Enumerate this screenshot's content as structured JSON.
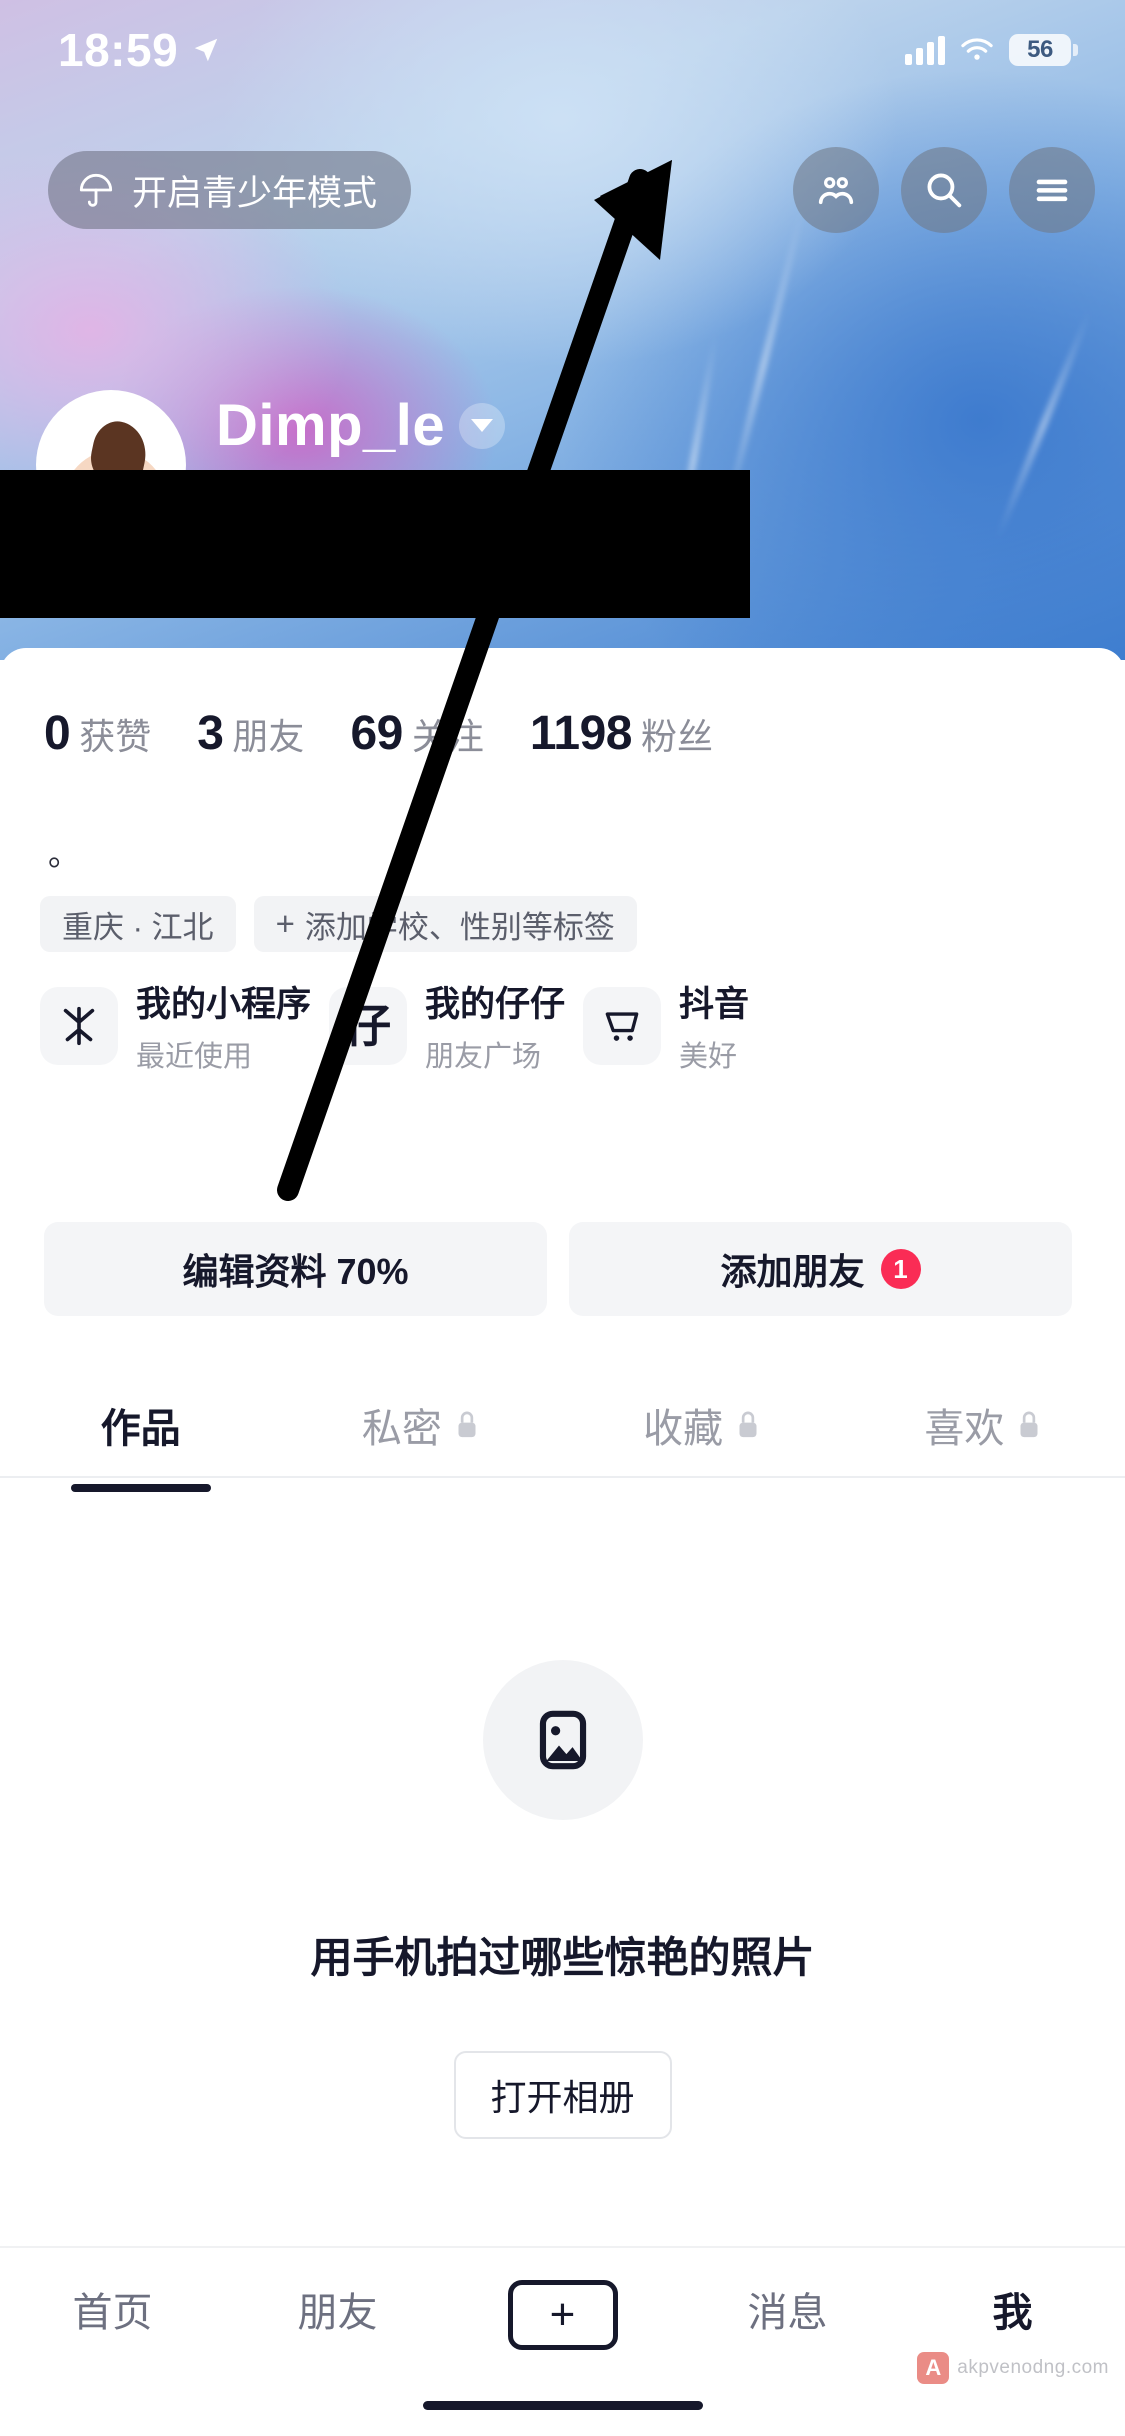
{
  "status_bar": {
    "time": "18:59",
    "location_icon": "location-arrow-icon",
    "signal_icon": "cellular-signal-icon",
    "wifi_icon": "wifi-icon",
    "battery_level": "56"
  },
  "header": {
    "teen_mode_label": "开启青少年模式",
    "teen_mode_icon": "umbrella-icon",
    "buttons": [
      {
        "name": "friends-icon",
        "label": ""
      },
      {
        "name": "search-icon",
        "label": ""
      },
      {
        "name": "menu-icon",
        "label": ""
      }
    ]
  },
  "profile": {
    "username": "Dimp_le",
    "dropdown_icon": "chevron-down-icon",
    "avatar_icon": "avatar",
    "bio": "。",
    "stats": [
      {
        "value": "0",
        "label": "获赞"
      },
      {
        "value": "3",
        "label": "朋友"
      },
      {
        "value": "69",
        "label": "关注"
      },
      {
        "value": "1198",
        "label": "粉丝"
      }
    ],
    "tags": [
      {
        "text": "重庆 · 江北",
        "has_plus": false
      },
      {
        "text": "添加学校、性别等标签",
        "has_plus": true
      }
    ]
  },
  "services": [
    {
      "icon": "douyin-mini-program-icon",
      "title": "我的小程序",
      "subtitle": "最近使用"
    },
    {
      "icon": "zaizai-icon",
      "title": "我的仔仔",
      "subtitle": "朋友广场"
    },
    {
      "icon": "shopping-cart-icon",
      "title": "抖音",
      "subtitle": "美好"
    }
  ],
  "actions": [
    {
      "label": "编辑资料 70%",
      "badge": ""
    },
    {
      "label": "添加朋友",
      "badge": "1"
    }
  ],
  "tabs": [
    {
      "label": "作品",
      "locked": false,
      "active": true
    },
    {
      "label": "私密",
      "locked": true,
      "active": false
    },
    {
      "label": "收藏",
      "locked": true,
      "active": false
    },
    {
      "label": "喜欢",
      "locked": true,
      "active": false
    }
  ],
  "empty_state": {
    "icon": "image-placeholder-icon",
    "text": "用手机拍过哪些惊艳的照片",
    "button_label": "打开相册"
  },
  "bottom_nav": [
    {
      "label": "首页",
      "active": false
    },
    {
      "label": "朋友",
      "active": false
    },
    {
      "label": "+",
      "active": false,
      "is_plus": true
    },
    {
      "label": "消息",
      "active": false
    },
    {
      "label": "我",
      "active": true
    }
  ],
  "watermark": {
    "logo": "A",
    "text": "akpvenodng.com"
  },
  "colors": {
    "accent_red": "#fa2c55",
    "text_primary": "#16182b",
    "text_secondary": "#9a9ca6",
    "chip_bg": "#f2f3f5"
  }
}
